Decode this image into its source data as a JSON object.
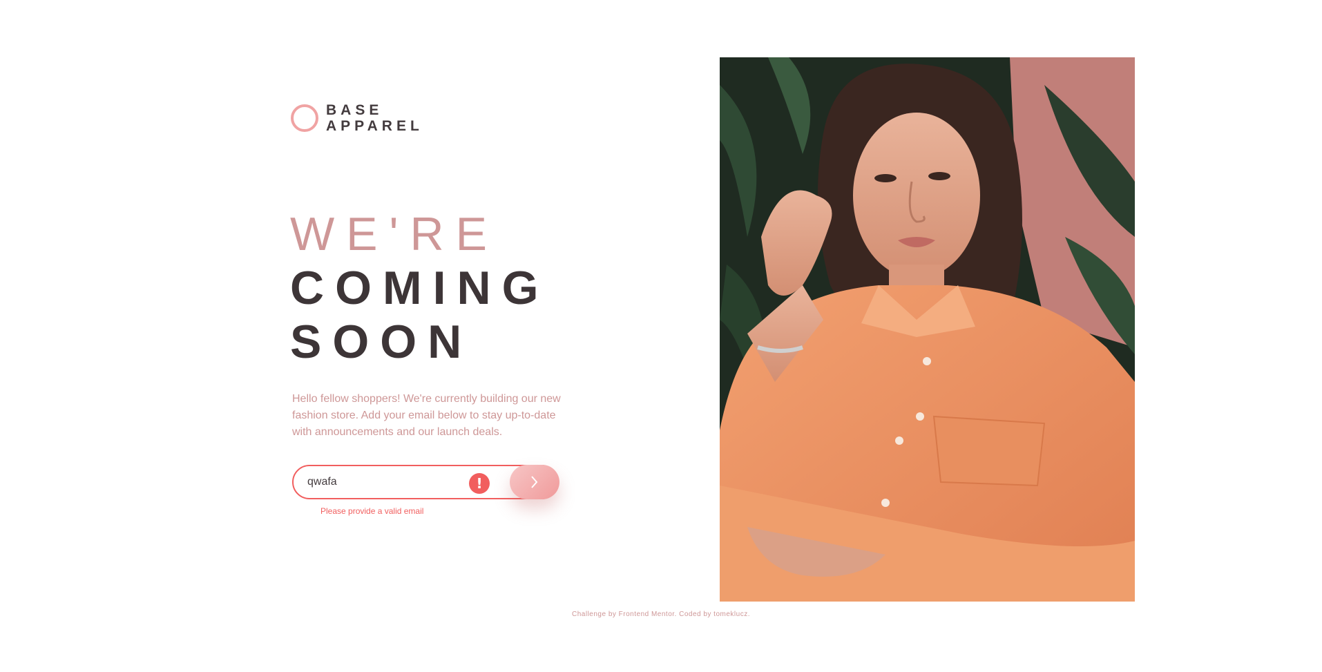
{
  "brand": {
    "line1": "BASE",
    "line2": "APPAREL"
  },
  "headline": {
    "line1": "WE'RE",
    "line2": "COMING",
    "line3": "SOON"
  },
  "intro": "Hello fellow shoppers! We're currently building our new fashion store. Add your email below to stay up-to-date with announcements and our launch deals.",
  "form": {
    "email_value": "qwafa",
    "error_message": "Please provide a valid email",
    "error_icon": "exclamation-icon",
    "submit_icon": "chevron-right-icon"
  },
  "hero": {
    "icon": "model-photo"
  },
  "footer": "Challenge by Frontend Mentor. Coded by tomeklucz.",
  "colors": {
    "accent": "#ce9797",
    "error": "#f15e5e",
    "dark": "#433b3e",
    "button_gradient_start": "#f7c6c6",
    "button_gradient_end": "#f09a9a"
  }
}
